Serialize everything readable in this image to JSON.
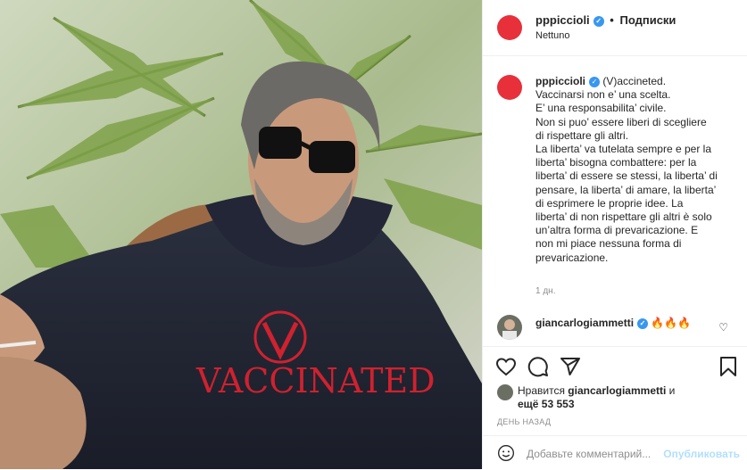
{
  "header": {
    "username": "pppiccioli",
    "separator": "•",
    "follow_label": "Подписки",
    "location": "Nettuno"
  },
  "photo": {
    "hoodie_text": "VACCINATED",
    "alt": "Man in sunglasses wearing a navy hoodie printed with VACCINATED and a V logo, seated in a wicker chair in front of palm leaves"
  },
  "caption": {
    "username": "pppiccioli",
    "lines": [
      "(V)accineted.",
      "Vaccinarsi non e’ una scelta.",
      "E’ una responsabilita’ civile.",
      "Non si puo’ essere liberi di scegliere",
      "di rispettare gli altri.",
      "La liberta’ va tutelata sempre e per la",
      "liberta’ bisogna combattere: per la",
      "liberta’ di essere se stessi, la liberta’ di",
      "pensare, la liberta’ di amare, la liberta’",
      "di esprimere le proprie idee. La",
      "liberta’ di non rispettare gli altri è solo",
      "un’altra forma di prevaricazione. E",
      "non mi piace nessuna forma di",
      "prevaricazione."
    ],
    "time": "1 дн."
  },
  "comment": {
    "username": "giancarlogiammetti",
    "text": "🔥🔥🔥"
  },
  "likes": {
    "prefix": "Нравится ",
    "user": "giancarlogiammetti",
    "mid": " и",
    "more": "ещё 53 553"
  },
  "posted_ago": "ДЕНЬ НАЗАД",
  "add_comment": {
    "placeholder": "Добавьте комментарий...",
    "publish_label": "Опубликовать"
  },
  "colors": {
    "avatar": "#e8303a",
    "verified": "#3897f0",
    "publish_disabled": "#b2dffc",
    "hoodie_print": "#d0212f"
  },
  "icons": [
    "verified-badge-icon",
    "heart-icon",
    "comment-icon",
    "share-icon",
    "bookmark-icon",
    "emoji-icon"
  ]
}
